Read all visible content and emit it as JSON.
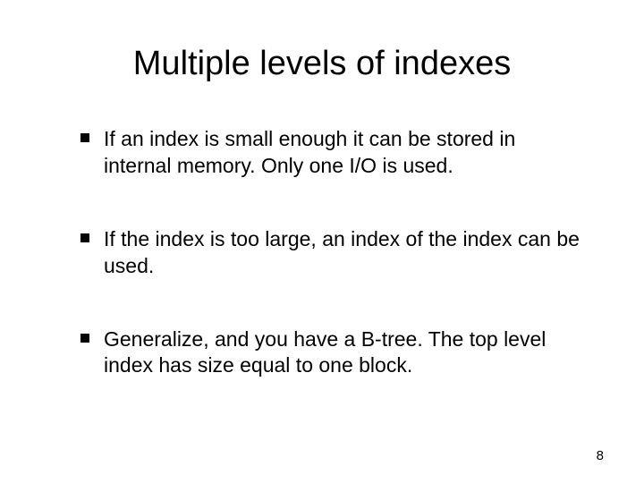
{
  "slide": {
    "title": "Multiple levels of indexes",
    "bullets": [
      "If an index is small enough it can be stored in internal memory. Only one I/O is used.",
      "If the index is too large, an index of the index can be used.",
      "Generalize, and you have a B-tree. The top level index has size equal to one block."
    ],
    "page_number": "8"
  }
}
